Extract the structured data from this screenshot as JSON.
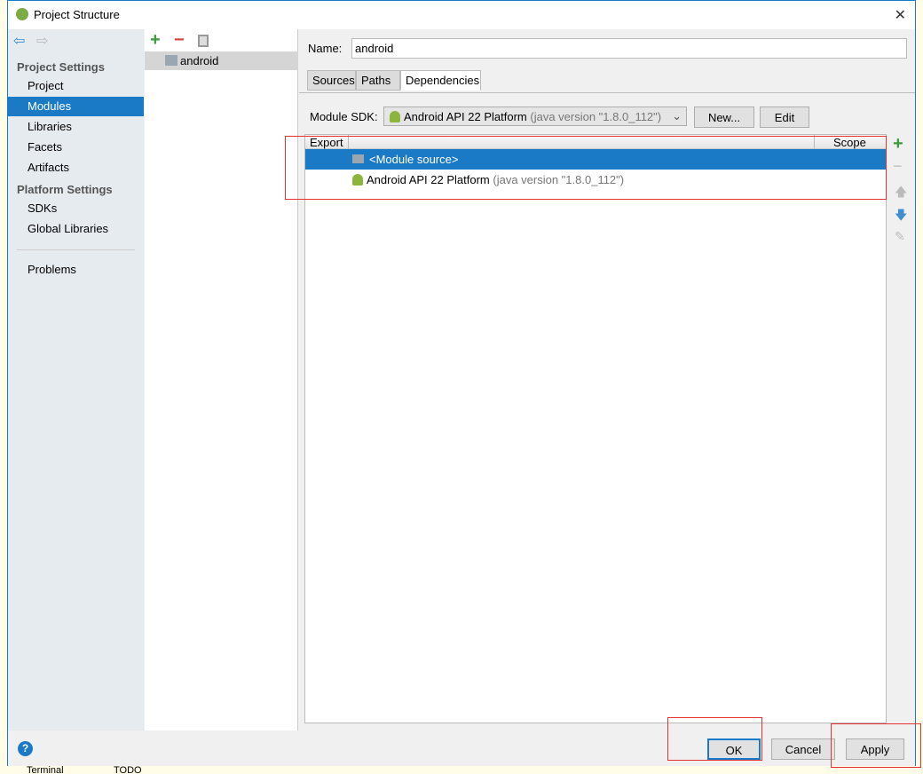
{
  "window": {
    "title": "Project Structure",
    "close": "✕"
  },
  "sidebar": {
    "project_settings": "Project Settings",
    "platform_settings": "Platform Settings",
    "items": [
      "Project",
      "Modules",
      "Libraries",
      "Facets",
      "Artifacts"
    ],
    "platform_items": [
      "SDKs",
      "Global Libraries"
    ],
    "problems": "Problems",
    "selected": "Modules"
  },
  "modules": {
    "items": [
      "android"
    ]
  },
  "name": {
    "label": "Name:",
    "value": "android"
  },
  "tabs": [
    "Sources",
    "Paths",
    "Dependencies"
  ],
  "active_tab": "Dependencies",
  "sdk": {
    "label": "Module SDK:",
    "value": "Android API 22 Platform",
    "detail": "(java version \"1.8.0_112\")",
    "new": "New...",
    "edit": "Edit"
  },
  "table": {
    "headers": [
      "Export",
      "Scope"
    ],
    "rows": [
      {
        "name": "<Module source>",
        "detail": "",
        "selected": true
      },
      {
        "name": "Android API 22 Platform",
        "detail": "(java version \"1.8.0_112\")",
        "selected": false
      }
    ]
  },
  "footer": {
    "help": "?",
    "ok": "OK",
    "cancel": "Cancel",
    "apply": "Apply"
  },
  "taskbar": {
    "terminal": "Terminal",
    "todo": "TODO"
  },
  "colors": {
    "selection": "#1b7ac5",
    "annotation": "#e53333",
    "add": "#3c9a3c",
    "remove": "#d9453d"
  }
}
